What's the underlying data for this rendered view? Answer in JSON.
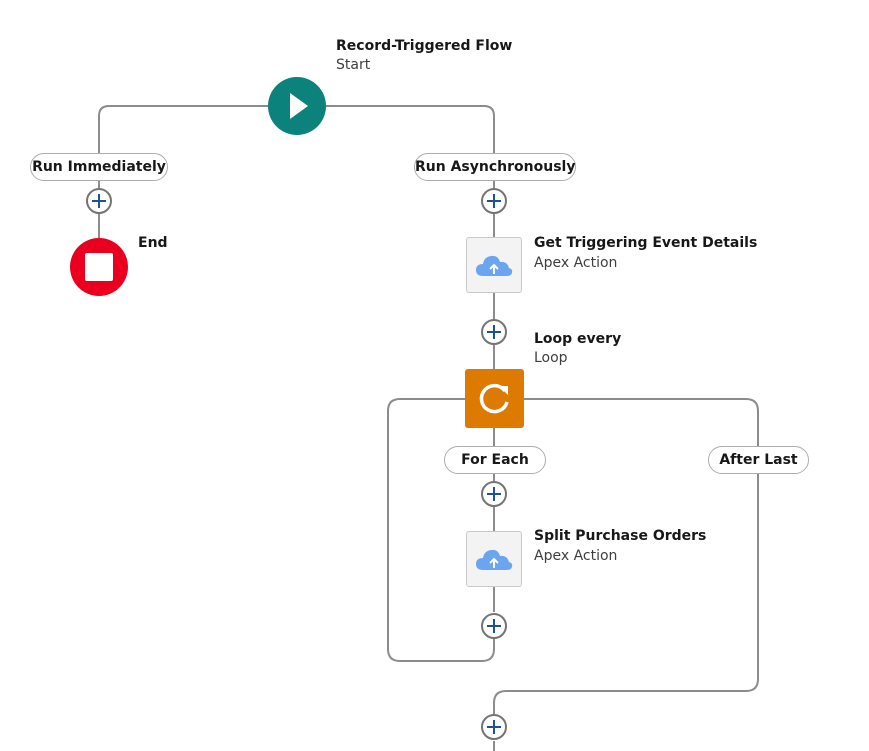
{
  "start": {
    "title": "Record-Triggered Flow",
    "subtitle": "Start",
    "color": "#0b827c",
    "icon": "play-icon"
  },
  "paths": {
    "immediate_label": "Run Immediately",
    "async_label": "Run Asynchronously"
  },
  "end": {
    "title": "End",
    "color": "#ea001e",
    "icon": "stop-icon"
  },
  "nodes": {
    "get_event": {
      "title": "Get Triggering Event Details",
      "subtitle": "Apex Action",
      "icon": "cloud-upload-icon"
    },
    "loop": {
      "title": "Loop every",
      "subtitle": "Loop",
      "color": "#dd7a01",
      "icon": "loop-refresh-icon",
      "for_each_label": "For Each",
      "after_last_label": "After Last"
    },
    "split_orders": {
      "title": "Split Purchase Orders",
      "subtitle": "Apex Action",
      "icon": "cloud-upload-icon"
    }
  },
  "add_icon": "plus-icon",
  "colors": {
    "connector": "#8c8c8c",
    "cloud": "#6ba4ef",
    "add_plus": "#1b5297"
  }
}
